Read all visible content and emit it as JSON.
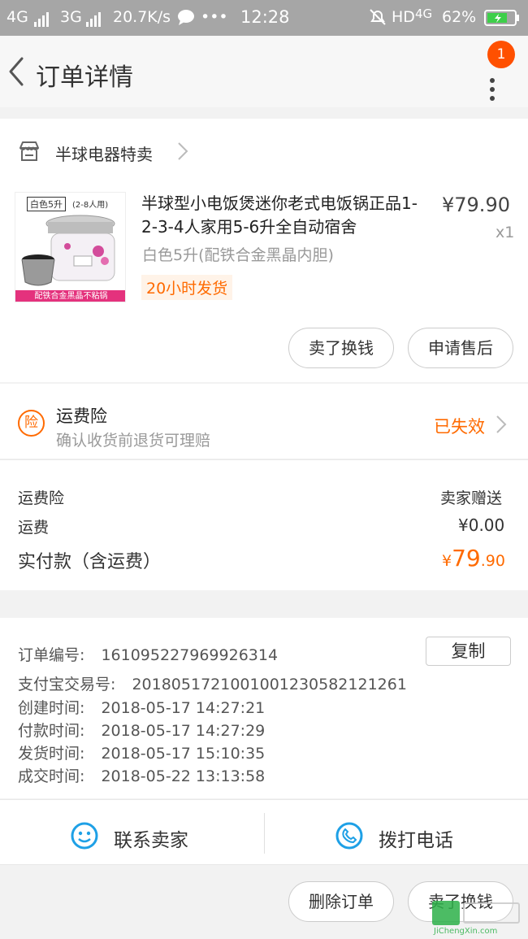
{
  "status_bar": {
    "network1": "4G",
    "network2": "3G",
    "speed": "20.7K/s",
    "more": "•••",
    "time": "12:28",
    "hd": "HD",
    "network3": "4G",
    "battery": "62%"
  },
  "header": {
    "title": "订单详情",
    "badge_count": "1"
  },
  "shop": {
    "name": "半球电器特卖"
  },
  "product": {
    "image_tag_color": "白色5升",
    "image_tag_people": "(2-8人用)",
    "image_caption": "配铁合金黑晶不粘锅",
    "title": "半球型小电饭煲迷你老式电饭锅正品1-2-3-4人家用5-6升全自动宿舍",
    "price": "¥79.90",
    "quantity": "x1",
    "sku": "白色5升(配铁合金黑晶内胆)",
    "shipping_tag": "20小时发货"
  },
  "product_actions": {
    "sell_label": "卖了换钱",
    "after_sale_label": "申请售后"
  },
  "insurance": {
    "icon_char": "险",
    "title": "运费险",
    "subtitle": "确认收货前退货可理赔",
    "status": "已失效"
  },
  "costs": {
    "insurance_label": "运费险",
    "insurance_value": "卖家赠送",
    "freight_label": "运费",
    "freight_value": "¥0.00",
    "paid_label": "实付款（含运费）",
    "paid_currency": "¥",
    "paid_int": "79",
    "paid_dec": ".90"
  },
  "order_info": {
    "order_no_label": "订单编号:",
    "order_no": "161095227969926314",
    "copy_label": "复制",
    "alipay_label": "支付宝交易号:",
    "alipay_no": "2018051721001001230582121261",
    "created_label": "创建时间:",
    "created": "2018-05-17 14:27:21",
    "paid_label": "付款时间:",
    "paid": "2018-05-17 14:27:29",
    "shipped_label": "发货时间:",
    "shipped": "2018-05-17 15:10:35",
    "completed_label": "成交时间:",
    "completed": "2018-05-22 13:13:58"
  },
  "contact": {
    "seller_label": "联系卖家",
    "phone_label": "拨打电话"
  },
  "footer": {
    "delete_label": "删除订单",
    "sell_label": "卖了换钱"
  },
  "watermark": {
    "text": "JiChengXin.com"
  },
  "colors": {
    "accent": "#ff6a00",
    "badge": "#ff5000",
    "icon_blue": "#1ea0e6"
  }
}
